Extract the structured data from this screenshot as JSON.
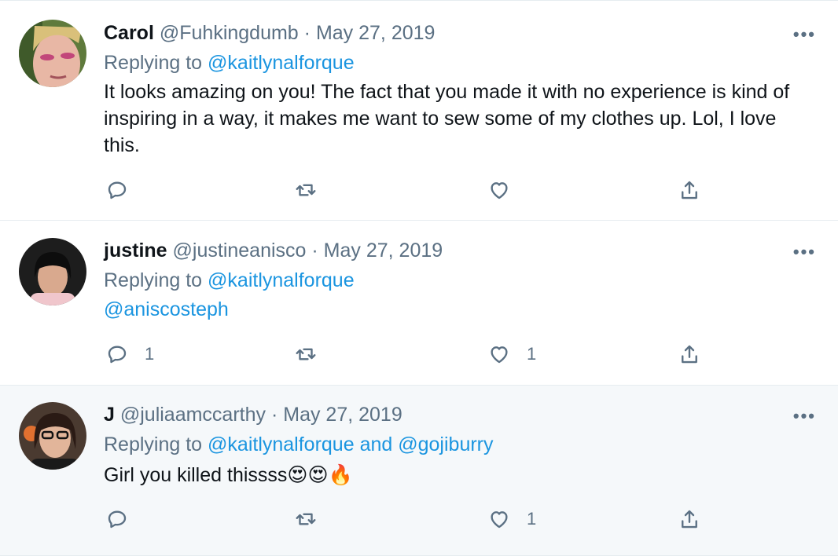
{
  "colors": {
    "link": "#1b95e0",
    "muted": "#5b7083",
    "text": "#0f1419",
    "divider": "#e6ecf0",
    "highlight_bg": "#f5f8fa"
  },
  "tweets": [
    {
      "name": "Carol",
      "handle": "@Fuhkingdumb",
      "date": "· May 27, 2019",
      "replying_prefix": "Replying to",
      "replying_to": "@kaitlynalforque",
      "text": "It looks amazing on you! The fact that you made it with no experience is kind of inspiring in a way, it makes me want to sew some of my clothes up. Lol, I love this.",
      "reply_count": "",
      "retweet_count": "",
      "like_count": ""
    },
    {
      "name": "justine",
      "handle": "@justineanisco",
      "date": "· May 27, 2019",
      "replying_prefix": "Replying to",
      "replying_to": "@kaitlynalforque",
      "mention": "@aniscosteph",
      "reply_count": "1",
      "retweet_count": "",
      "like_count": "1"
    },
    {
      "name": "J",
      "handle": "@juliaamccarthy",
      "date": "· May 27, 2019",
      "replying_prefix": "Replying to",
      "replying_to": "@kaitlynalforque",
      "replying_and": "and",
      "replying_to_2": "@gojiburry",
      "text": "Girl you killed thissss",
      "emojis": [
        "😍",
        "😍",
        "🔥"
      ],
      "reply_count": "",
      "retweet_count": "",
      "like_count": "1"
    }
  ],
  "icons": {
    "reply": "reply-icon",
    "retweet": "retweet-icon",
    "like": "heart-icon",
    "share": "share-icon",
    "more": "more-options-icon"
  },
  "more_glyph": "•••"
}
